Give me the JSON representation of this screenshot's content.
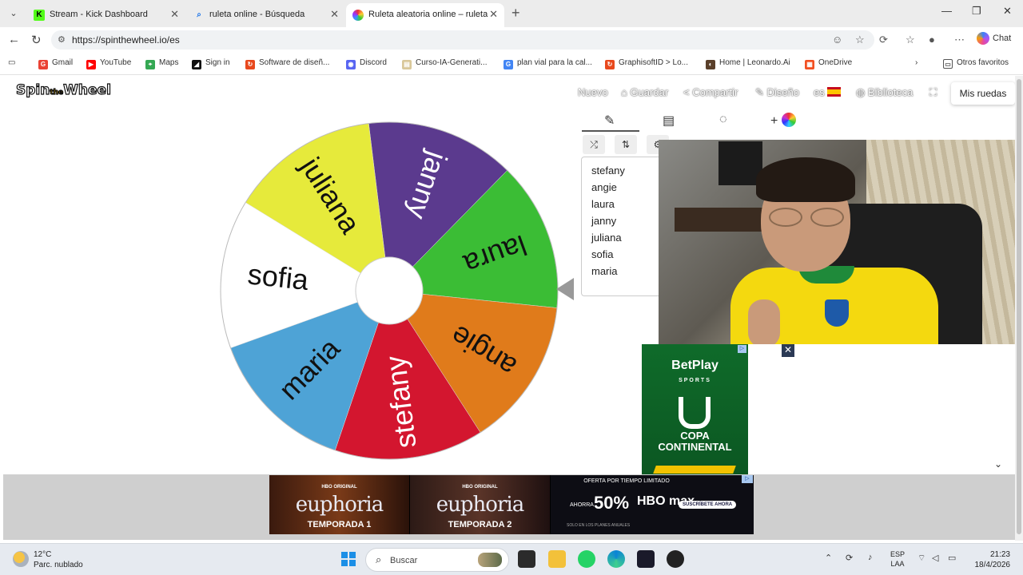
{
  "browser": {
    "tabs": [
      {
        "title": "Stream - Kick Dashboard",
        "active": false
      },
      {
        "title": "ruleta online - Búsqueda",
        "active": false
      },
      {
        "title": "Ruleta aleatoria online – ruleta de",
        "active": true
      }
    ],
    "url": "https://spinthewheel.io/es",
    "chat_label": "Chat"
  },
  "bookmarks": [
    {
      "label": "Gmail",
      "color": "#ea4335"
    },
    {
      "label": "YouTube",
      "color": "#ff0000"
    },
    {
      "label": "Maps",
      "color": "#34a853"
    },
    {
      "label": "Sign in",
      "color": "#111111"
    },
    {
      "label": "Software de diseñ...",
      "color": "#e8491d"
    },
    {
      "label": "Discord",
      "color": "#5865f2"
    },
    {
      "label": "Curso-IA-Generati...",
      "color": "#d9c89a"
    },
    {
      "label": "plan vial para la cal...",
      "color": "#4285f4"
    },
    {
      "label": "GraphisoftID > Lo...",
      "color": "#e8491d"
    },
    {
      "label": "Home | Leonardo.Ai",
      "color": "#5a3f2a"
    },
    {
      "label": "OneDrive",
      "color": "#f25022"
    }
  ],
  "bookmarks_other": "Otros favoritos",
  "site": {
    "logo_a": "Spin",
    "logo_b": "the",
    "logo_c": "Wheel",
    "menu": {
      "nuevo": "Nuevo",
      "guardar": "Guardar",
      "compartir": "Compartir",
      "diseno": "Diseño",
      "lang": "es",
      "biblioteca": "Biblioteca"
    },
    "mis_ruedas": "Mis ruedas"
  },
  "wheel": {
    "segments": [
      {
        "name": "janny",
        "color": "#5b3a8e",
        "text": "#ffffff"
      },
      {
        "name": "laura",
        "color": "#3bbd35",
        "text": "#111111"
      },
      {
        "name": "angie",
        "color": "#e07b1b",
        "text": "#111111"
      },
      {
        "name": "stefany",
        "color": "#d3162f",
        "text": "#ffffff"
      },
      {
        "name": "maria",
        "color": "#4ea3d6",
        "text": "#111111"
      },
      {
        "name": "sofia",
        "color": "#ffffff",
        "text": "#111111"
      },
      {
        "name": "juliana",
        "color": "#e6ea3b",
        "text": "#111111"
      }
    ]
  },
  "entries": [
    "stefany",
    "angie",
    "laura",
    "janny",
    "juliana",
    "sofia",
    "maria"
  ],
  "ads": {
    "betplay": {
      "brand": "BetPlay",
      "sub": "SPORTS",
      "title_1": "COPA",
      "title_2": "CONTINENTAL"
    },
    "hbo": {
      "hbo_tag": "HBO ORIGINAL",
      "show": "euphoria",
      "t1": "TEMPORADA 1",
      "t2": "TEMPORADA 2",
      "offer_top": "OFERTA POR TIEMPO LIMITADO",
      "ahorra": "AHORRA",
      "pct": "50%",
      "brand": "HBO max",
      "cta": "SUSCRÍBETE AHORA",
      "fine": "SOLO EN LOS PLANES ANUALES"
    }
  },
  "taskbar": {
    "temp": "12°C",
    "weather": "Parc. nublado",
    "search": "Buscar",
    "lang_1": "ESP",
    "lang_2": "LAA",
    "time": "21:23",
    "date": "18/4/2026"
  }
}
